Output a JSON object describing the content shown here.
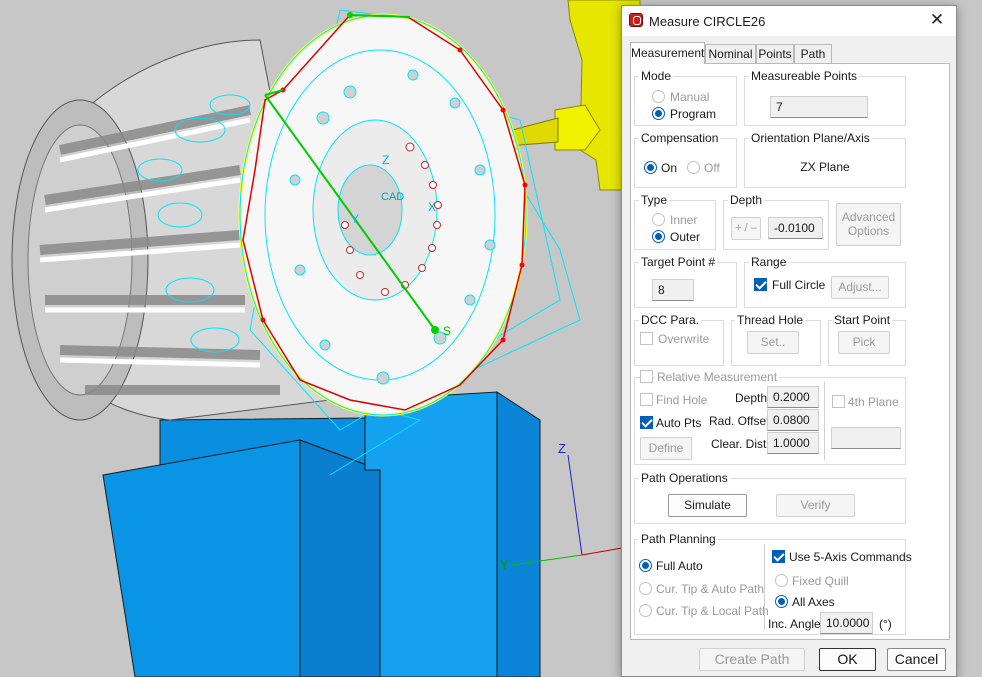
{
  "viewport": {
    "axis_labels": {
      "z": "Z",
      "y": "Y"
    },
    "part_labels": {
      "cad": "CAD",
      "s": "S",
      "y": "Y",
      "x": "X",
      "z": "Z"
    }
  },
  "dialog": {
    "title": "Measure CIRCLE26",
    "tabs": [
      "Measurement",
      "Nominal",
      "Points",
      "Path"
    ],
    "mode": {
      "label": "Mode",
      "manual": "Manual",
      "program": "Program",
      "selected": "Program"
    },
    "measurable_points": {
      "label": "Measureable Points",
      "value": "7"
    },
    "compensation": {
      "label": "Compensation",
      "on": "On",
      "off": "Off",
      "selected": "On"
    },
    "orientation": {
      "label": "Orientation Plane/Axis",
      "value": "ZX Plane"
    },
    "type": {
      "label": "Type",
      "inner": "Inner",
      "outer": "Outer",
      "selected": "Outer"
    },
    "depth": {
      "label": "Depth",
      "toggle": "+ / –",
      "value": "-0.0100"
    },
    "advanced_options": "Advanced Options",
    "target_point": {
      "label": "Target Point #",
      "value": "8"
    },
    "range": {
      "label": "Range",
      "full_circle": "Full Circle",
      "full_circle_checked": true,
      "adjust": "Adjust..."
    },
    "dcc_para": {
      "label": "DCC Para.",
      "overwrite": "Overwrite",
      "checked": false
    },
    "thread_hole": {
      "label": "Thread Hole",
      "set": "Set.."
    },
    "start_point": {
      "label": "Start Point",
      "pick": "Pick"
    },
    "relative": {
      "label": "Relative Measurement",
      "find_hole": "Find Hole",
      "auto_pts": "Auto Pts",
      "auto_pts_checked": true,
      "define": "Define",
      "depth_label": "Depth",
      "depth_value": "0.2000",
      "rad_offset_label": "Rad. Offset",
      "rad_offset_value": "0.0800",
      "clear_dist_label": "Clear. Dist.",
      "clear_dist_value": "1.0000",
      "fourth_plane": "4th Plane"
    },
    "path_operations": {
      "label": "Path Operations",
      "simulate": "Simulate",
      "verify": "Verify"
    },
    "path_planning": {
      "label": "Path Planning",
      "full_auto": "Full Auto",
      "cur_tip_auto": "Cur. Tip & Auto Path",
      "cur_tip_local": "Cur. Tip & Local Path",
      "selected": "Full Auto",
      "use_5axis": "Use 5-Axis Commands",
      "use_5axis_checked": true,
      "fixed_quill": "Fixed Quill",
      "all_axes": "All Axes",
      "axes_selected": "All Axes",
      "inc_angle_label": "Inc. Angle",
      "inc_angle_value": "10.0000",
      "inc_angle_unit": "(°)"
    },
    "buttons": {
      "create_path": "Create Path",
      "ok": "OK",
      "cancel": "Cancel"
    }
  },
  "colors": {
    "accent": "#005fb8",
    "part_outline": "#00e5ff",
    "circle_yellow": "#ffff33",
    "path_red": "#e00000",
    "fixture_blue": "#0a94e6",
    "probe_yellow": "#e6e600"
  }
}
